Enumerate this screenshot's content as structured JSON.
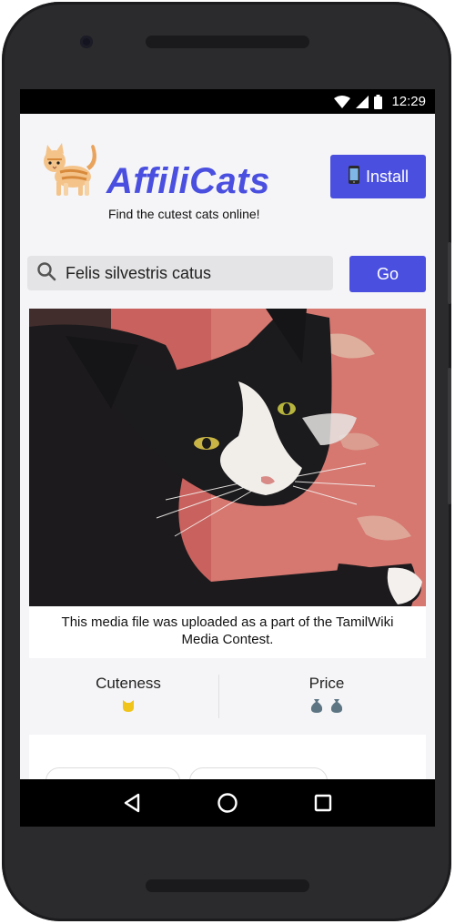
{
  "status_bar": {
    "time": "12:29",
    "icons": [
      "wifi-icon",
      "cell-signal-icon",
      "battery-icon"
    ]
  },
  "app": {
    "brand": "AffiliCats",
    "tagline": "Find the cutest cats online!",
    "logo_icon": "cat-emoji",
    "install_button": {
      "icon": "mobile-phone-icon",
      "label": "Install"
    },
    "accent_color": "#4a4fe0"
  },
  "search": {
    "value": "Felis silvestris catus",
    "go_label": "Go"
  },
  "card": {
    "photo_icon": "cat-photo",
    "caption": "This media file was uploaded as a part of the TamilWiki Media Contest.",
    "stats": [
      {
        "label": "Cuteness",
        "icon": "cat-face-icon",
        "count": 1,
        "color": "#f0c419"
      },
      {
        "label": "Price",
        "icon": "money-bag-icon",
        "count": 2,
        "color": "#5d7583"
      }
    ]
  },
  "navbar": {
    "buttons": [
      "back-icon",
      "home-icon",
      "recents-icon"
    ]
  }
}
